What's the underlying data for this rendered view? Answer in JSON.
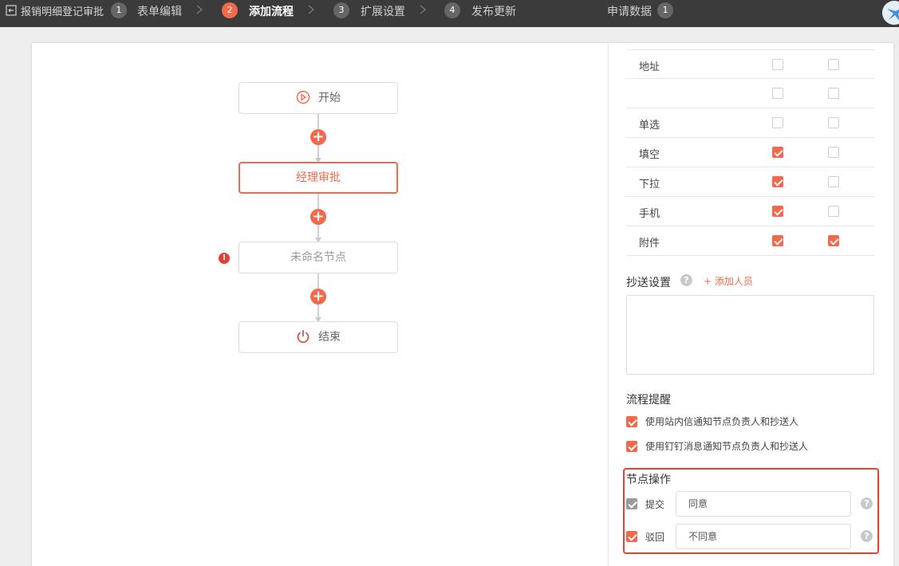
{
  "topbar": {
    "app_title": "报销明细登记审批",
    "steps": [
      {
        "num": "1",
        "label": "表单编辑",
        "active": false
      },
      {
        "num": "2",
        "label": "添加流程",
        "active": true
      },
      {
        "num": "3",
        "label": "扩展设置",
        "active": false
      },
      {
        "num": "4",
        "label": "发布更新",
        "active": false
      }
    ],
    "requests_label": "申请数据",
    "requests_count": "1"
  },
  "flow": {
    "nodes": [
      {
        "label": "开始",
        "icon": "play-icon"
      },
      {
        "label": "经理审批",
        "icon": ""
      },
      {
        "label": "未命名节点",
        "icon": ""
      },
      {
        "label": "结束",
        "icon": "power-icon"
      }
    ],
    "add_symbol": "+",
    "warning_symbol": "!"
  },
  "fields": [
    {
      "name": "地址",
      "c1": false,
      "c2": false
    },
    {
      "name": "",
      "c1": false,
      "c2": false
    },
    {
      "name": "单选",
      "c1": false,
      "c2": false
    },
    {
      "name": "填空",
      "c1": true,
      "c2": false
    },
    {
      "name": "下拉",
      "c1": true,
      "c2": false
    },
    {
      "name": "手机",
      "c1": true,
      "c2": false
    },
    {
      "name": "附件",
      "c1": true,
      "c2": true
    }
  ],
  "cc": {
    "title": "抄送设置",
    "help": "?",
    "add_label": "+ 添加人员"
  },
  "reminder": {
    "title": "流程提醒",
    "options": [
      {
        "label": "使用站内信通知节点负责人和抄送人",
        "checked": true
      },
      {
        "label": "使用钉钉消息通知节点负责人和抄送人",
        "checked": true
      }
    ]
  },
  "node_ops": {
    "title": "节点操作",
    "ops": [
      {
        "label": "提交",
        "value": "同意",
        "checked": true,
        "disabled": true
      },
      {
        "label": "驳回",
        "value": "不同意",
        "checked": true,
        "disabled": false
      }
    ],
    "help": "?"
  },
  "colors": {
    "accent": "#f26a4b",
    "topbar": "#3b3b3b",
    "highlight_border": "#e8412f"
  }
}
